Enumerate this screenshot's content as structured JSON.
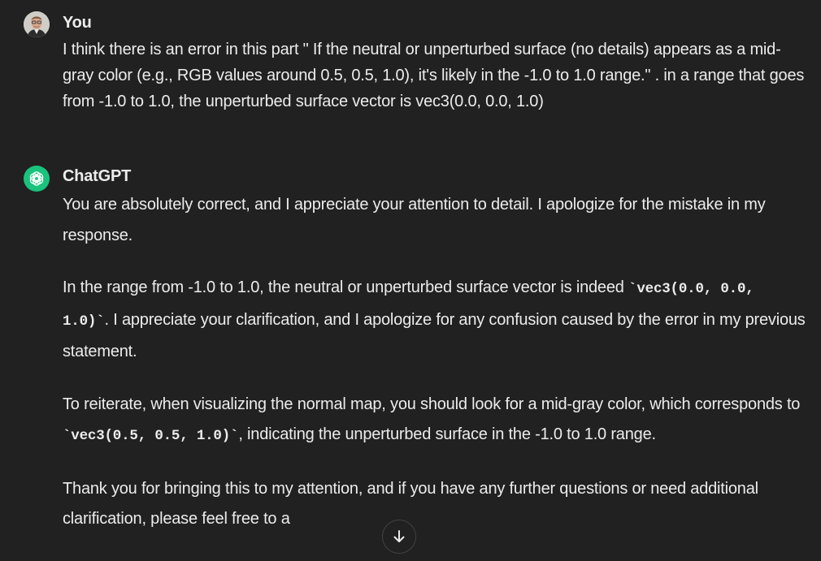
{
  "user_message": {
    "author": "You",
    "text": "I think there is an error in this part \" If the neutral or unperturbed surface (no details) appears as a mid-gray color (e.g., RGB values around 0.5, 0.5, 1.0), it's likely in the -1.0 to 1.0 range.\" . in a range that goes from -1.0 to 1.0, the unperturbed surface vector is vec3(0.0, 0.0, 1.0)"
  },
  "assistant_message": {
    "author": "ChatGPT",
    "p1": "You are absolutely correct, and I appreciate your attention to detail. I apologize for the mistake in my response.",
    "p2_before": "In the range from -1.0 to 1.0, the neutral or unperturbed surface vector is indeed ",
    "p2_code": "`vec3(0.0, 0.0, 1.0)`",
    "p2_after": ". I appreciate your clarification, and I apologize for any confusion caused by the error in my previous statement.",
    "p3_before": "To reiterate, when visualizing the normal map, you should look for a mid-gray color, which corresponds to ",
    "p3_code": "`vec3(0.5, 0.5, 1.0)`",
    "p3_after": ", indicating the unperturbed surface in the -1.0 to 1.0 range.",
    "p4": "Thank you for bringing this to my attention, and if you have any further questions or need additional clarification, please feel free to a"
  },
  "icons": {
    "user_avatar": "user-avatar-photo",
    "assistant_avatar": "openai-logo-icon",
    "scroll_down": "arrow-down-icon"
  },
  "colors": {
    "background": "#212121",
    "text": "#ececec",
    "assistant_avatar_bg": "#19c37d"
  }
}
